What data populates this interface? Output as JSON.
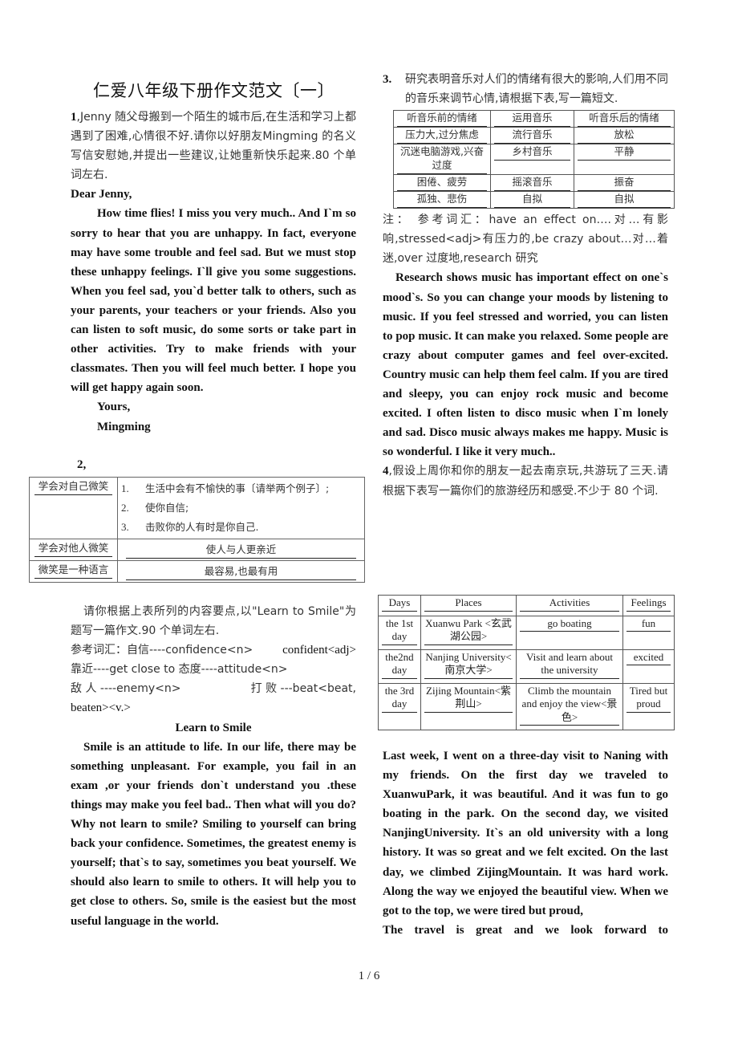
{
  "document": {
    "title": "仁爱八年级下册作文范文〔一〕",
    "page_indicator": "1 / 6"
  },
  "task1": {
    "number": "1",
    "prompt": ",Jenny 随父母搬到一个陌生的城市后,在生活和学习上都遇到了困难,心情很不好.请你以好朋友Mingming 的名义写信安慰她,并提出一些建议,让她重新快乐起来.80 个单词左右.",
    "salutation": "Dear Jenny,",
    "body": "How time flies! I miss you very much.. And I`m so sorry to hear that you are unhappy. In fact, everyone may have some trouble and feel sad. But we must stop these unhappy feelings. I`ll give you some suggestions. When you feel sad, you`d better talk to others, such as your parents, your teachers or your friends. Also you can listen to soft music, do some sorts or take part in other activities. Try to make friends with your classmates. Then you will feel much better. I hope you will get happy again soon.",
    "closing": "Yours,",
    "signature": "Mingming"
  },
  "task2": {
    "number": "2,",
    "table": [
      {
        "label": "学会对自己微笑",
        "items": [
          {
            "num": "1.",
            "text": "生活中会有不愉快的事〔请举两个例子〕;"
          },
          {
            "num": "2.",
            "text": "使你自信;"
          },
          {
            "num": "3.",
            "text": "击败你的人有时是你自己."
          }
        ]
      },
      {
        "label": "学会对他人微笑",
        "content": "使人与人更亲近"
      },
      {
        "label": "微笑是一种语言",
        "content": "最容易,也最有用"
      }
    ],
    "prompt": "请你根据上表所列的内容要点,以\"Learn to Smile\"为题写一篇作文.90 个单词左右.",
    "vocab_line1_a": "参考词汇：自信----confidence<n>",
    "vocab_line1_b": "confident<adj>",
    "vocab_line2": "靠近----get    close to  态度----attitude<n>",
    "vocab_line3_a": "敌 人 ----enemy<n>",
    "vocab_line3_b": "打 败 ---beat<beat,",
    "vocab_line4": "beaten><v.>",
    "essay_title": "Learn to Smile",
    "essay": "Smile is an attitude to life. In our life, there may be something unpleasant. For example, you fail in an exam ,or your friends don`t understand you .these things may make you feel bad.. Then what will you do? Why not learn to smile? Smiling to yourself can bring back your confidence. Sometimes, the greatest enemy is yourself; that`s to say, sometimes you beat yourself. We should also learn to smile to others. It will help you to get close to others. So, smile is the easiest but the most useful language in the world."
  },
  "task3": {
    "number": "3.",
    "prompt": "研究表明音乐对人们的情绪有很大的影响,人们用不同的音乐来调节心情,请根据下表,写一篇短文.",
    "table_headers": [
      "听音乐前的情绪",
      "运用音乐",
      "听音乐后的情绪"
    ],
    "table_rows": [
      [
        "压力大,过分焦虑",
        "流行音乐",
        "放松"
      ],
      [
        "沉迷电脑游戏,兴奋过度",
        "乡村音乐",
        "平静"
      ],
      [
        "困倦、疲劳",
        "摇滚音乐",
        "振奋"
      ],
      [
        "孤独、悲伤",
        "自拟",
        "自拟"
      ]
    ],
    "note": "注： 参考词汇：have an effect on….对…有影响,stressed<adj>有压力的,be crazy about…对…着迷,over 过度地,research 研究",
    "essay": "Research shows music has important effect on one`s mood`s. So you can change your moods by listening to music. If you feel stressed and worried, you can listen to pop music. It can make you relaxed. Some people are crazy about computer games and feel over-excited. Country music can help them feel calm. If you are tired and sleepy, you can enjoy rock music and become excited. I often listen to disco music when I`m lonely and sad. Disco music always makes me happy. Music is so wonderful. I like it very much.."
  },
  "task4": {
    "number": "4",
    "prompt": ",假设上周你和你的朋友一起去南京玩,共游玩了三天.请根据下表写一篇你们的旅游经历和感受.不少于 80 个词.",
    "table_headers": [
      "Days",
      "Places",
      "Activities",
      "Feelings"
    ],
    "table_rows": [
      [
        "the 1st day",
        "Xuanwu Park <玄武湖公园>",
        "go boating",
        "fun"
      ],
      [
        "the2nd day",
        "Nanjing University<南京大学>",
        "Visit and learn about the university",
        "excited"
      ],
      [
        "the 3rd day",
        "Zijing Mountain<紫荆山>",
        "Climb the mountain and enjoy the view<景色>",
        "Tired but proud"
      ]
    ],
    "essay": "Last week, I went on a three-day visit to Naning with my friends. On the first day we traveled to XuanwuPark, it was beautiful. And it was fun to go boating in the park. On the second day, we visited NanjingUniversity. It`s an old university with a long history. It was so great and we felt excited. On the last day, we climbed ZijingMountain. It was hard work. Along the way we enjoyed the beautiful view. When we got to the top, we were tired but proud,",
    "essay_continued": "The travel is great and we look forward to"
  }
}
